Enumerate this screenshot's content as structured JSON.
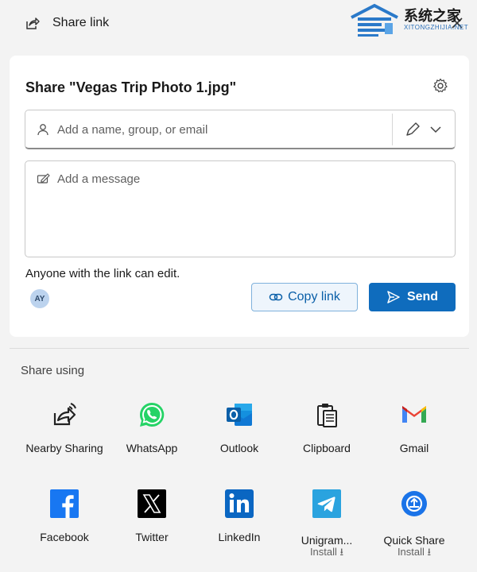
{
  "header": {
    "title": "Share link"
  },
  "watermark": {
    "main": "系统之家",
    "sub": "XITONGZHIJIA.NET"
  },
  "card": {
    "heading": "Share \"Vegas Trip Photo 1.jpg\"",
    "people_placeholder": "Add a name, group, or email",
    "message_placeholder": "Add a message",
    "permission_note": "Anyone with the link can edit.",
    "avatar_initials": "AY",
    "copy_label": "Copy link",
    "send_label": "Send"
  },
  "share_using": {
    "label": "Share using",
    "apps": [
      {
        "label": "Nearby Sharing",
        "icon": "nearby-sharing-icon"
      },
      {
        "label": "WhatsApp",
        "icon": "whatsapp-icon"
      },
      {
        "label": "Outlook",
        "icon": "outlook-icon"
      },
      {
        "label": "Clipboard",
        "icon": "clipboard-icon"
      },
      {
        "label": "Gmail",
        "icon": "gmail-icon"
      },
      {
        "label": "Facebook",
        "icon": "facebook-icon"
      },
      {
        "label": "Twitter",
        "icon": "twitter-x-icon"
      },
      {
        "label": "LinkedIn",
        "icon": "linkedin-icon"
      },
      {
        "label": "Unigram...",
        "sub": "Install ⭳",
        "icon": "unigram-icon"
      },
      {
        "label": "Quick Share",
        "sub": "Install ⭳",
        "icon": "quick-share-icon"
      }
    ]
  },
  "colors": {
    "accent": "#0f6cbd",
    "whatsapp": "#25d366",
    "outlook": "#0f78d4",
    "gmail": "#ea4335",
    "facebook": "#1877f2",
    "linkedin": "#0a66c2",
    "telegram": "#2aa3df"
  }
}
